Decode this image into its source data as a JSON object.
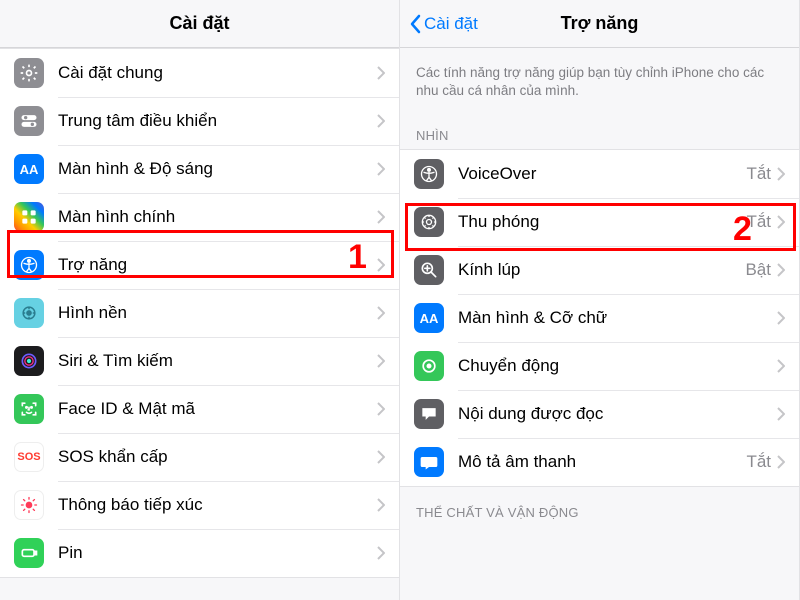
{
  "annotations": {
    "step1": "1",
    "step2": "2"
  },
  "left": {
    "title": "Cài đặt",
    "rows": [
      {
        "id": "general",
        "label": "Cài đặt chung"
      },
      {
        "id": "control",
        "label": "Trung tâm điều khiển"
      },
      {
        "id": "display",
        "label": "Màn hình & Độ sáng"
      },
      {
        "id": "home",
        "label": "Màn hình chính"
      },
      {
        "id": "accessibility",
        "label": "Trợ năng"
      },
      {
        "id": "wallpaper",
        "label": "Hình nền"
      },
      {
        "id": "siri",
        "label": "Siri & Tìm kiếm"
      },
      {
        "id": "faceid",
        "label": "Face ID & Mật mã"
      },
      {
        "id": "sos",
        "label": "SOS khẩn cấp"
      },
      {
        "id": "exposure",
        "label": "Thông báo tiếp xúc"
      },
      {
        "id": "battery",
        "label": "Pin"
      }
    ]
  },
  "right": {
    "back": "Cài đặt",
    "title": "Trợ năng",
    "description": "Các tính năng trợ năng giúp bạn tùy chỉnh iPhone cho các nhu cầu cá nhân của mình.",
    "section_vision": "NHÌN",
    "section_physical": "THỂ CHẤT VÀ VẬN ĐỘNG",
    "rows": [
      {
        "id": "voiceover",
        "label": "VoiceOver",
        "status": "Tắt"
      },
      {
        "id": "zoom",
        "label": "Thu phóng",
        "status": "Tắt"
      },
      {
        "id": "magnifier",
        "label": "Kính lúp",
        "status": "Bật"
      },
      {
        "id": "textsize",
        "label": "Màn hình & Cỡ chữ",
        "status": ""
      },
      {
        "id": "motion",
        "label": "Chuyển động",
        "status": ""
      },
      {
        "id": "spoken",
        "label": "Nội dung được đọc",
        "status": ""
      },
      {
        "id": "audiodesc",
        "label": "Mô tả âm thanh",
        "status": "Tắt"
      }
    ]
  }
}
